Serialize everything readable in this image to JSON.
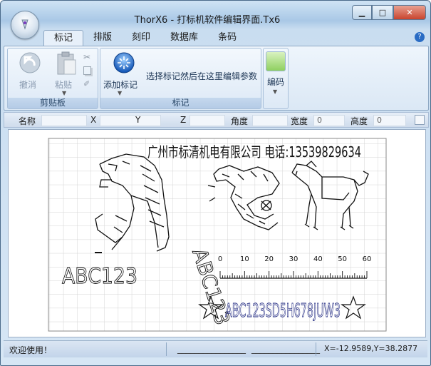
{
  "window": {
    "title": "ThorX6 - 打标机软件编辑界面.Tx6"
  },
  "tabs": [
    {
      "label": "标记",
      "active": true
    },
    {
      "label": "排版"
    },
    {
      "label": "刻印"
    },
    {
      "label": "数据库"
    },
    {
      "label": "条码"
    }
  ],
  "ribbon": {
    "clipboard": {
      "group_label": "剪贴板",
      "undo_label": "撤消",
      "paste_label": "粘贴"
    },
    "mark": {
      "group_label": "标记",
      "add_label": "添加标记",
      "hint": "选择标记然后在这里编辑参数"
    },
    "code": {
      "label": "编码"
    }
  },
  "props": {
    "name_label": "名称",
    "x_label": "X",
    "y_label": "Y",
    "z_label": "Z",
    "angle_label": "角度",
    "width_label": "宽度",
    "width_value": "0",
    "height_label": "高度",
    "height_value": "0"
  },
  "canvas": {
    "company_text": "广州市标清机电有限公司  电话:13539829634",
    "text1": "ABC123",
    "arc_text": "ABC123",
    "text2": "ABC123SD5H678JUW3",
    "ruler_labels": [
      "0",
      "10",
      "20",
      "30",
      "40",
      "50",
      "60"
    ]
  },
  "status": {
    "message": "欢迎使用！",
    "field1": "________________",
    "field2": "________________",
    "coords": "X=-12.9589,Y=38.2877"
  }
}
